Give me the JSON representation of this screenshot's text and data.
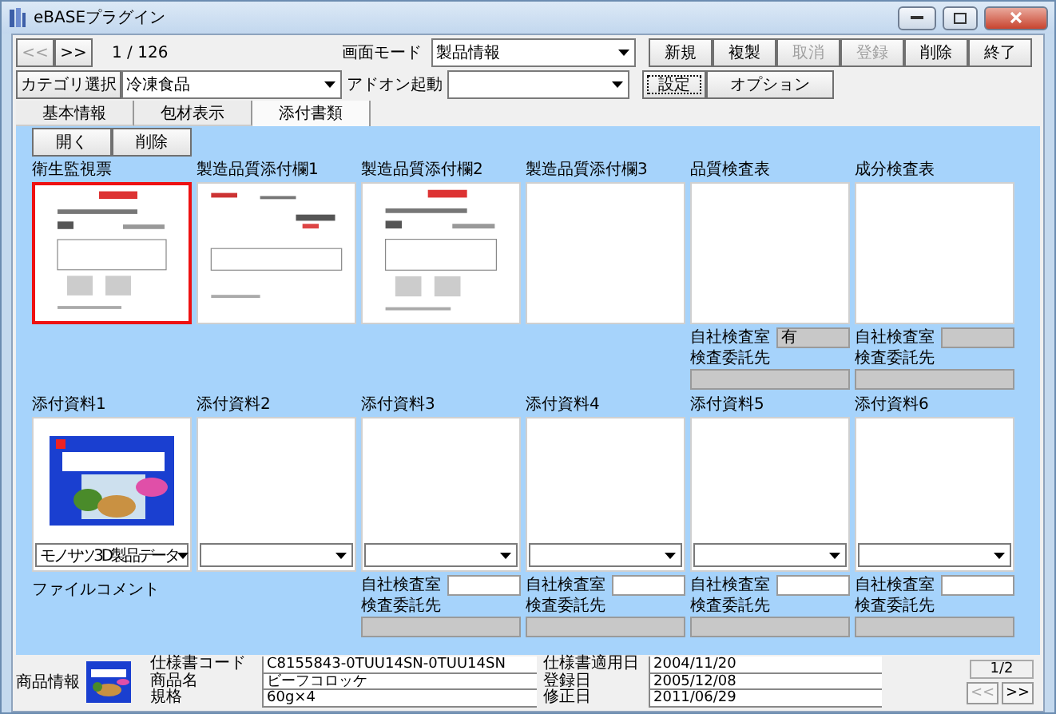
{
  "window": {
    "title": "eBASEプラグイン"
  },
  "nav": {
    "prev": "<<",
    "next": ">>",
    "position": "1 / 126"
  },
  "mode": {
    "label": "画面モード",
    "value": "製品情報"
  },
  "actions": [
    {
      "label": "新規",
      "disabled": false
    },
    {
      "label": "複製",
      "disabled": false
    },
    {
      "label": "取消",
      "disabled": true
    },
    {
      "label": "登録",
      "disabled": true
    },
    {
      "label": "削除",
      "disabled": false
    },
    {
      "label": "終了",
      "disabled": false
    }
  ],
  "category": {
    "label": "カテゴリ選択",
    "value": "冷凍食品"
  },
  "addon": {
    "label": "アドオン起動"
  },
  "settings_button": {
    "label": "設定",
    "focused": true
  },
  "options_button": {
    "label": "オプション"
  },
  "tabs": [
    {
      "label": "基本情報",
      "selected": false
    },
    {
      "label": "包材表示",
      "selected": false
    },
    {
      "label": "添付書類",
      "selected": true
    }
  ],
  "panel_buttons": [
    "開く",
    "削除"
  ],
  "documents": [
    {
      "label": "衛生監視票",
      "kind": "document",
      "selected": true
    },
    {
      "label": "製造品質添付欄1",
      "kind": "letter",
      "selected": false
    },
    {
      "label": "製造品質添付欄2",
      "kind": "document",
      "selected": false
    },
    {
      "label": "製造品質添付欄3",
      "kind": "empty",
      "selected": false
    },
    {
      "label": "品質検査表",
      "kind": "empty",
      "selected": false,
      "inspection": {
        "in_house_label": "自社検査室",
        "in_house_value": "有",
        "outsource_label": "検査委託先"
      }
    },
    {
      "label": "成分検査表",
      "kind": "empty",
      "selected": false,
      "inspection": {
        "in_house_label": "自社検査室",
        "outsource_label": "検査委託先"
      }
    }
  ],
  "attachments": [
    {
      "label": "添付資料1",
      "kind": "product",
      "file_type": "モノサツ3D製品データ",
      "comment_label": "ファイルコメント"
    },
    {
      "label": "添付資料2",
      "kind": "empty"
    },
    {
      "label": "添付資料3",
      "kind": "empty",
      "inspection": {
        "in_house_label": "自社検査室",
        "outsource_label": "検査委託先"
      }
    },
    {
      "label": "添付資料4",
      "kind": "empty",
      "inspection": {
        "in_house_label": "自社検査室",
        "outsource_label": "検査委託先"
      }
    },
    {
      "label": "添付資料5",
      "kind": "empty",
      "inspection": {
        "in_house_label": "自社検査室",
        "outsource_label": "検査委託先"
      }
    },
    {
      "label": "添付資料6",
      "kind": "empty",
      "inspection": {
        "in_house_label": "自社検査室",
        "outsource_label": "検査委託先"
      }
    }
  ],
  "product_info": {
    "label": "商品情報",
    "fields": [
      {
        "label": "仕様書コード",
        "value": "C8155843-0TUU14SN-0TUU14SN"
      },
      {
        "label": "仕様書適用日",
        "value": "2004/11/20"
      },
      {
        "label": "商品名",
        "value": "ビーフコロッケ"
      },
      {
        "label": "登録日",
        "value": "2005/12/08"
      },
      {
        "label": "規格",
        "value": "60g×4"
      },
      {
        "label": "修正日",
        "value": "2011/06/29"
      }
    ],
    "page": "1/2",
    "prev": "<<",
    "next": ">>",
    "prev_disabled": true
  }
}
